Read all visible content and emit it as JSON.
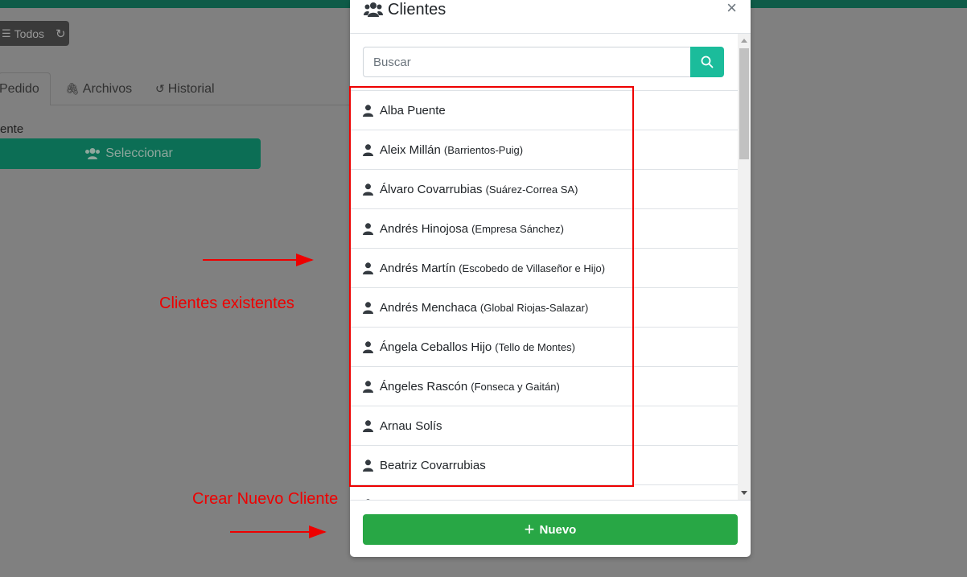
{
  "background": {
    "todos_label": "Todos",
    "tabs": [
      {
        "label": "Pedido"
      },
      {
        "label": "Archivos"
      },
      {
        "label": "Historial"
      }
    ],
    "cliente_label": "ente",
    "select_button_label": "Seleccionar"
  },
  "modal": {
    "title": "Clientes",
    "close_symbol": "×",
    "search": {
      "placeholder": "Buscar"
    },
    "clients": [
      {
        "name": "Alba Puente",
        "company": ""
      },
      {
        "name": "Aleix Millán",
        "company": "(Barrientos-Puig)"
      },
      {
        "name": "Álvaro Covarrubias",
        "company": "(Suárez-Correa SA)"
      },
      {
        "name": "Andrés Hinojosa",
        "company": "(Empresa Sánchez)"
      },
      {
        "name": "Andrés Martín",
        "company": "(Escobedo de Villaseñor e Hijo)"
      },
      {
        "name": "Andrés Menchaca",
        "company": "(Global Riojas-Salazar)"
      },
      {
        "name": "Ángela Ceballos Hijo",
        "company": "(Tello de Montes)"
      },
      {
        "name": "Ángeles Rascón",
        "company": "(Fonseca y Gaitán)"
      },
      {
        "name": "Arnau Solís",
        "company": ""
      },
      {
        "name": "Beatriz Covarrubias",
        "company": ""
      }
    ],
    "new_button_label": "Nuevo"
  },
  "annotations": {
    "existing_clients": "Clientes existentes",
    "create_new_client": "Crear Nuevo Cliente"
  },
  "colors": {
    "accent_teal": "#1bbc9b",
    "new_button": "#28a745",
    "annotation_red": "#ee0000"
  }
}
